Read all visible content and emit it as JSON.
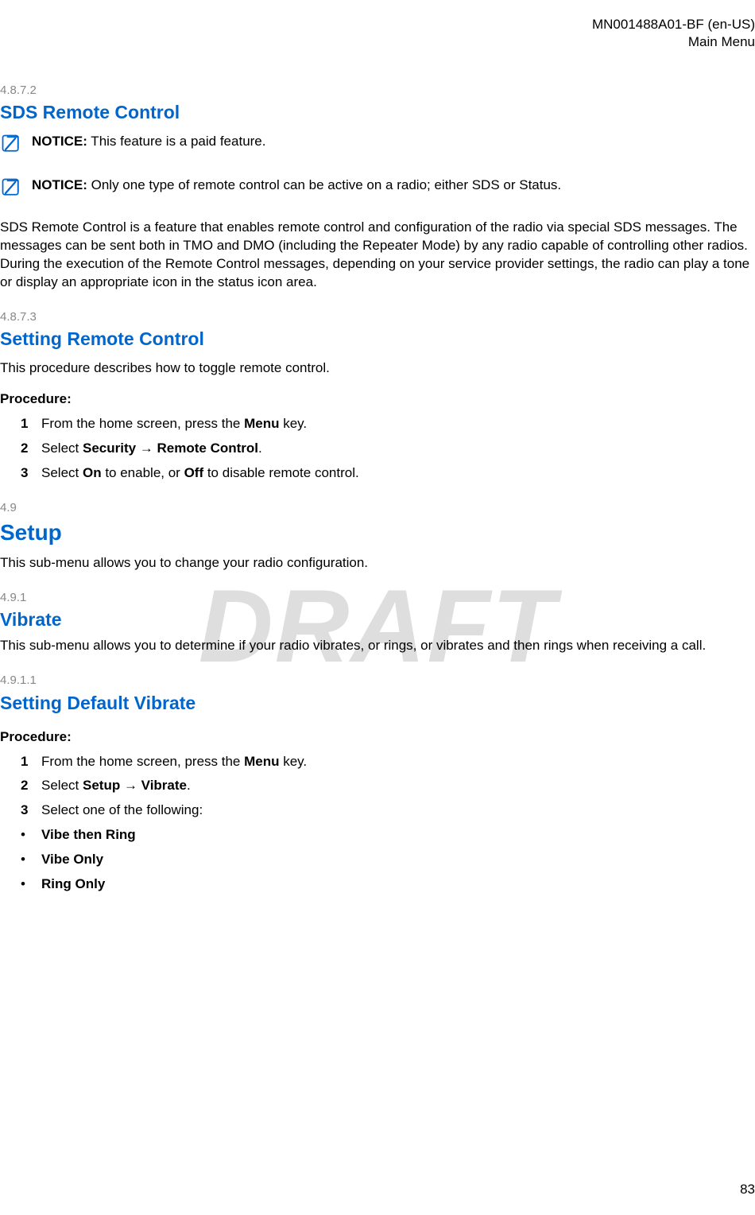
{
  "header": {
    "doc_id": "MN001488A01-BF (en-US)",
    "section": "Main Menu"
  },
  "watermark": "DRAFT",
  "s1": {
    "num": "4.8.7.2",
    "title": "SDS Remote Control",
    "notice1_label": "NOTICE:",
    "notice1_text": " This feature is a paid feature.",
    "notice2_label": "NOTICE:",
    "notice2_text": " Only one type of remote control can be active on a radio; either SDS or Status.",
    "para": "SDS Remote Control is a feature that enables remote control and configuration of the radio via special SDS messages. The messages can be sent both in TMO and DMO (including the Repeater Mode) by any radio capable of controlling other radios. During the execution of the Remote Control messages, depending on your service provider settings, the radio can play a tone or display an appropriate icon in the status icon area."
  },
  "s2": {
    "num": "4.8.7.3",
    "title": "Setting Remote Control",
    "intro": "This procedure describes how to toggle remote control.",
    "proc_label": "Procedure:",
    "step1_a": "From the home screen, press the ",
    "step1_b": "Menu",
    "step1_c": " key.",
    "step2_a": "Select ",
    "step2_b": "Security",
    "step2_arrow": " → ",
    "step2_c": "Remote Control",
    "step2_d": ".",
    "step3_a": "Select ",
    "step3_b": "On",
    "step3_c": " to enable, or ",
    "step3_d": "Off",
    "step3_e": " to disable remote control."
  },
  "s3": {
    "num": "4.9",
    "title": "Setup",
    "para": "This sub-menu allows you to change your radio configuration."
  },
  "s4": {
    "num": "4.9.1",
    "title": "Vibrate",
    "para": "This sub-menu allows you to determine if your radio vibrates, or rings, or vibrates and then rings when receiving a call."
  },
  "s5": {
    "num": "4.9.1.1",
    "title": "Setting Default Vibrate",
    "proc_label": "Procedure:",
    "step1_a": "From the home screen, press the ",
    "step1_b": "Menu",
    "step1_c": " key.",
    "step2_a": "Select ",
    "step2_b": "Setup",
    "step2_arrow": " → ",
    "step2_c": "Vibrate",
    "step2_d": ".",
    "step3": "Select one of the following:",
    "opt1": "Vibe then Ring",
    "opt2": "Vibe Only",
    "opt3": "Ring Only"
  },
  "page_num": "83",
  "nums": {
    "n1": "1",
    "n2": "2",
    "n3": "3"
  },
  "bullet": "•"
}
